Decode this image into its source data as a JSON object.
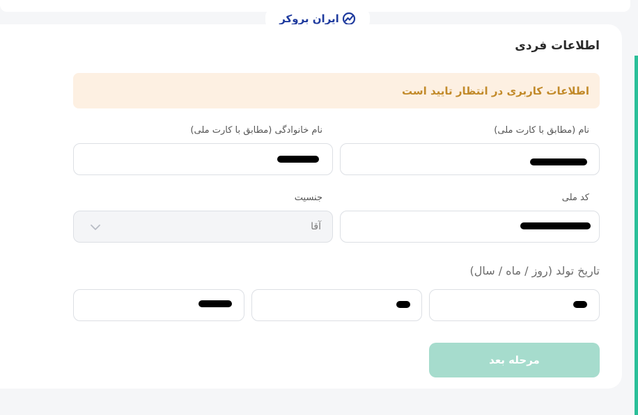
{
  "brand": {
    "logo_text": "ایران بروکر",
    "accent": "#2bbf99",
    "primary": "#1f3b9e"
  },
  "section": {
    "title": "اطلاعات فردی"
  },
  "alert": {
    "text": "اطلاعات کاربری در انتظار تایید است",
    "color": "#c28a2a",
    "background": "#fdf0e2"
  },
  "fields": {
    "first_name": {
      "label": "نام (مطابق با کارت ملی)",
      "value": ""
    },
    "last_name": {
      "label": "نام خانوادگی (مطابق با کارت ملی)",
      "value": ""
    },
    "national_code": {
      "label": "کد ملی",
      "value": ""
    },
    "gender": {
      "label": "جنسیت",
      "value": "آقا"
    }
  },
  "birth_date": {
    "label": "تاریخ تولد (روز / ماه / سال)"
  },
  "next_button": {
    "label": "مرحله بعد"
  }
}
